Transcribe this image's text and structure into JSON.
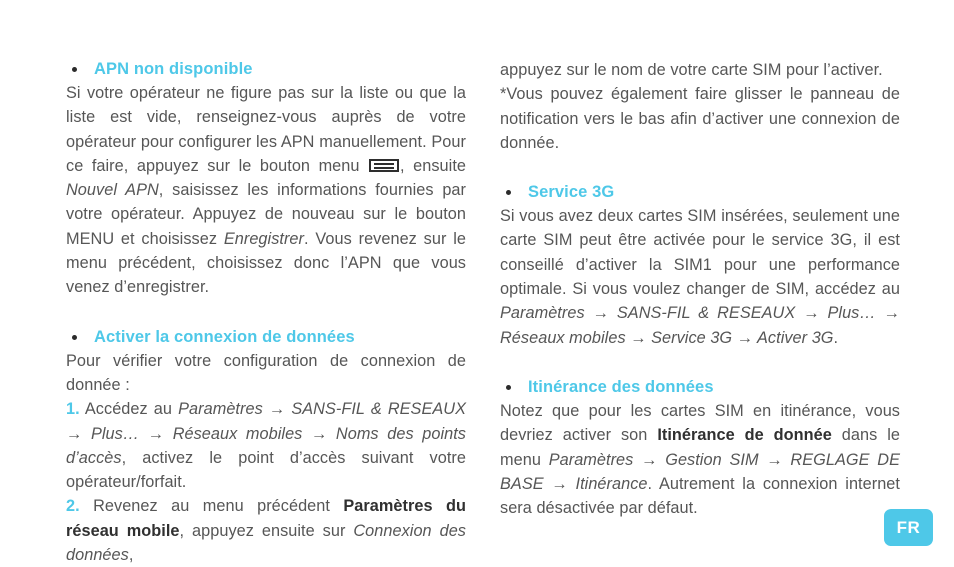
{
  "document": {
    "background_color": "#ffffff",
    "accent_color": "#4ec8e8",
    "body_text_color": "#565656"
  },
  "left_column": {
    "section_apn": {
      "heading": "APN non disponible",
      "paragraph_part1": "Si votre opérateur ne figure pas sur la liste ou que la liste est vide, renseignez-vous auprès de votre opérateur pour configurer les APN manuellement. Pour ce faire, appuyez sur le bouton menu",
      "menu_icon_name": "menu-button-icon",
      "paragraph_part2": ", ensuite ",
      "italic_nouvel_apn": "Nouvel APN",
      "paragraph_part3": ", saisissez les informations fournies par votre opérateur. Appuyez de nouveau sur le bouton MENU et choisissez ",
      "italic_enregistrer": "Enregistrer",
      "paragraph_part4": ". Vous revenez sur le menu précédent, choisissez donc l’APN que vous venez d’enregistrer."
    },
    "section_activer": {
      "heading": "Activer la connexion de données",
      "intro": "Pour vérifier votre configuration de connexion de donnée :",
      "step1_number": "1.",
      "step1_text_a": " Accédez au ",
      "step1_path": "Paramètres → SANS-FIL & RESEAUX → Plus… → Réseaux mobiles → Noms des points d’accès",
      "step1_text_b": ", activez le point d’accès suivant votre opérateur/forfait.",
      "step2_number": "2.",
      "step2_text_a": " Revenez au menu précédent ",
      "step2_bold": "Paramètres du réseau mobile",
      "step2_text_b": ", appuyez ensuite sur ",
      "step2_italic": "Connexion des données",
      "step2_text_c": ","
    }
  },
  "right_column": {
    "continuation": {
      "line_a": "appuyez sur le nom de votre carte SIM pour l’activer.",
      "line_b": "*Vous pouvez également faire glisser le panneau de notification vers le bas afin d’activer une connexion de donnée."
    },
    "section_3g": {
      "heading": "Service 3G",
      "paragraph_a": "Si vous avez deux cartes SIM insérées, seulement une carte SIM peut être activée pour le service 3G, il est conseillé d’activer la SIM1 pour une performance optimale. Si vous voulez changer de SIM, accédez au ",
      "path": "Paramètres → SANS-FIL & RESEAUX → Plus… → Réseaux mobiles → Service 3G → Activer 3G",
      "paragraph_b": "."
    },
    "section_itinerance": {
      "heading": "Itinérance des données",
      "paragraph_a": "Notez que pour les cartes SIM en itinérance, vous devriez activer son ",
      "bold_term": "Itinérance de donnée",
      "paragraph_b": " dans le menu ",
      "path": "Paramètres → Gestion SIM → REGLAGE DE BASE → Itinérance",
      "paragraph_c": ". Autrement la connexion internet sera désactivée par défaut."
    }
  },
  "language_badge": {
    "label": "FR"
  }
}
